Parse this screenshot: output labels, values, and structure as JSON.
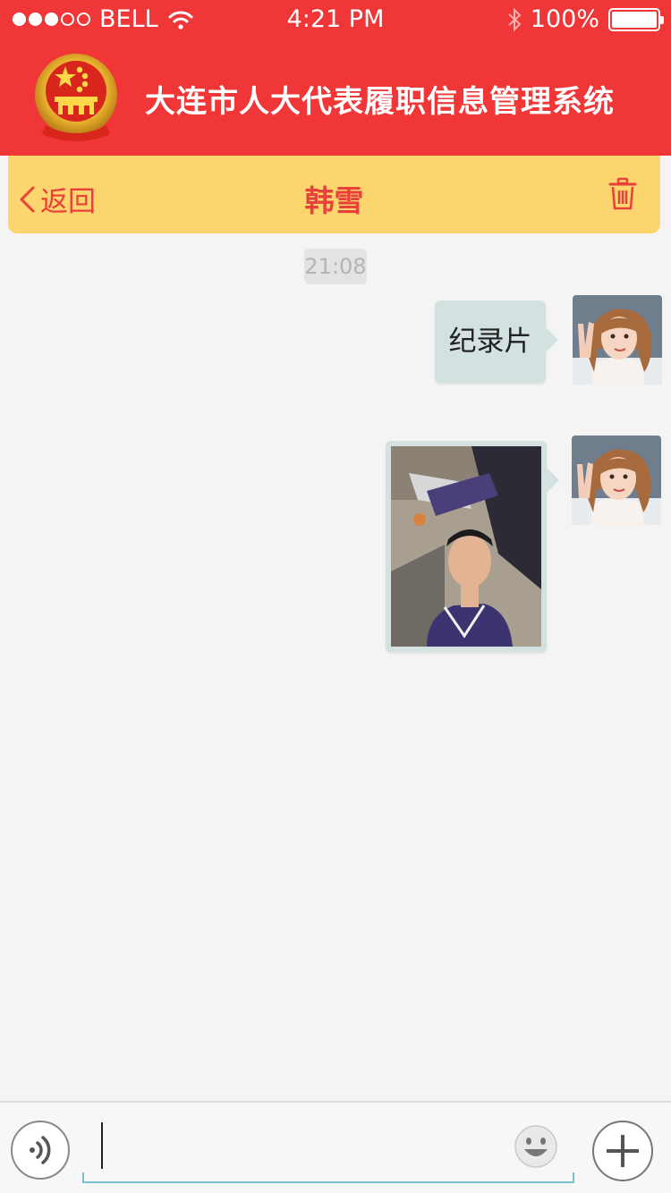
{
  "status_bar": {
    "carrier": "BELL",
    "time": "4:21 PM",
    "battery": "100%",
    "battery_level": 1.0,
    "signal_bars_filled": 3,
    "signal_bars_total": 5
  },
  "header": {
    "title": "大连市人大代表履职信息管理系统"
  },
  "nav": {
    "back_label": "返回",
    "chat_name": "韩雪"
  },
  "conversation": {
    "timestamp": "21:08",
    "messages": [
      {
        "type": "text",
        "text": "纪录片",
        "from": "self"
      },
      {
        "type": "image",
        "from": "self"
      }
    ]
  },
  "colors": {
    "header_red": "#f03636",
    "nav_yellow": "#fdd56e",
    "accent_red": "#e8403a",
    "bubble": "#d3e1e1",
    "input_underline": "#7ac2cc"
  },
  "icons": {
    "back": "chevron-left-icon",
    "delete": "trash-icon",
    "voice": "voice-icon",
    "emoji": "smiley-icon",
    "add": "plus-icon",
    "wifi": "wifi-icon",
    "bluetooth": "bluetooth-icon",
    "battery": "battery-icon"
  }
}
